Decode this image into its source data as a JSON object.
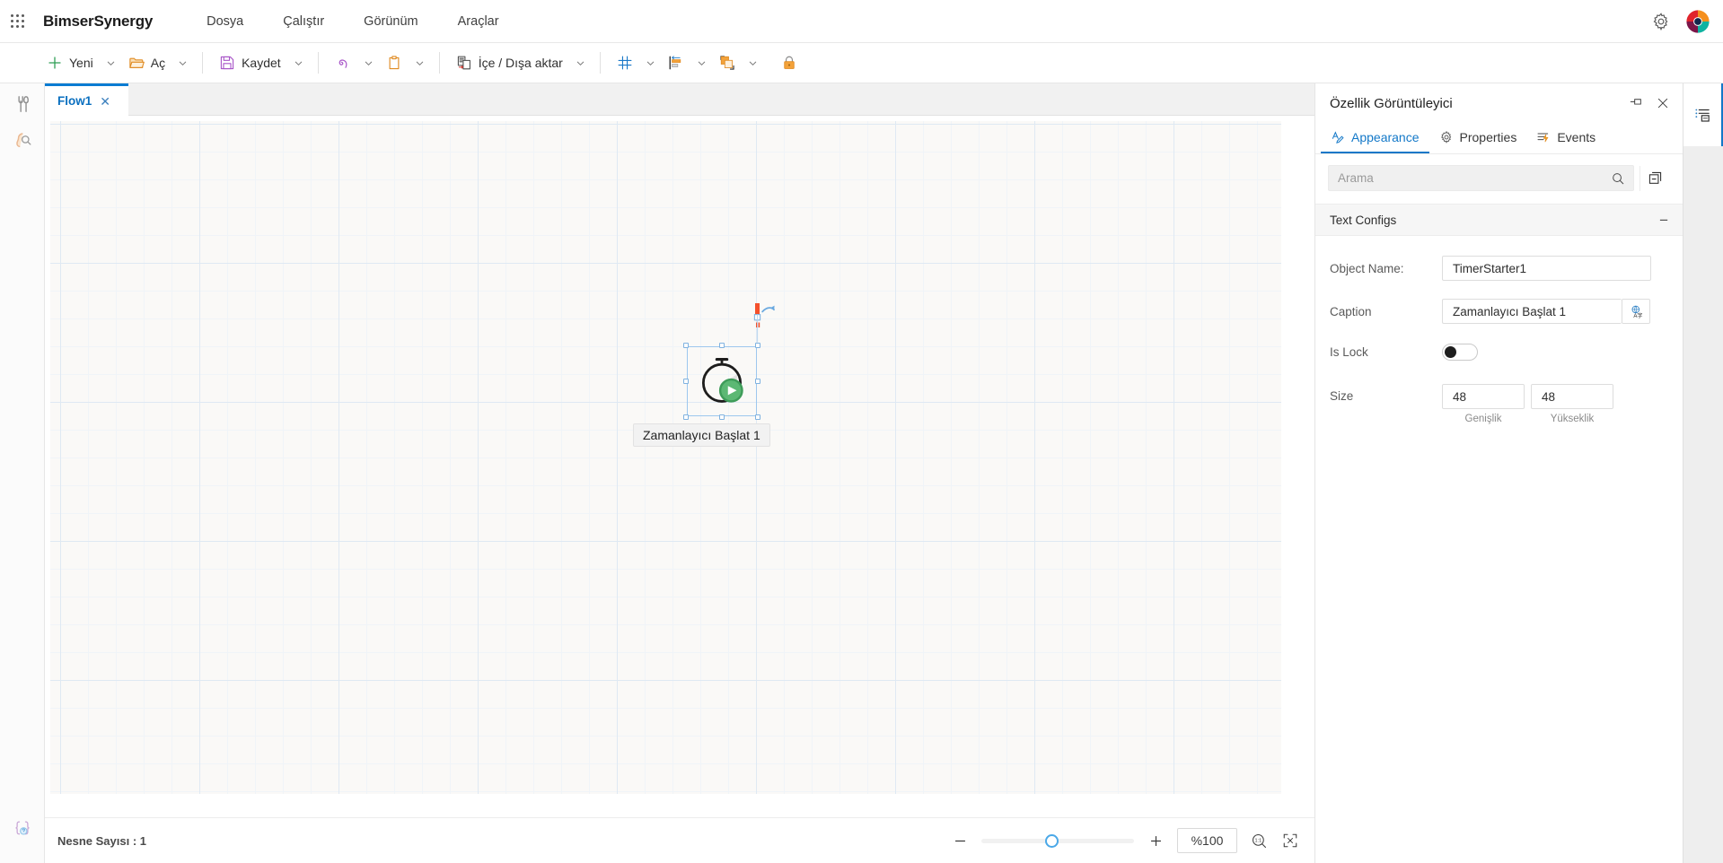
{
  "topbar": {
    "waffle_icon": "grid-apps-icon",
    "brand": "BimserSynergy",
    "menus": [
      {
        "label": "Dosya"
      },
      {
        "label": "Çalıştır"
      },
      {
        "label": "Görünüm"
      },
      {
        "label": "Araçlar"
      }
    ],
    "settings_icon": "gear-icon",
    "avatar_icon": "user-avatar-pinwheel"
  },
  "toolbar": {
    "items": [
      {
        "label": "Yeni",
        "icon": "plus-icon",
        "caret": true
      },
      {
        "label": "Aç",
        "icon": "folder-open-icon",
        "caret": true
      },
      {
        "label": "Kaydet",
        "icon": "floppy-save-icon",
        "caret": true
      },
      {
        "label": "",
        "icon": "undo-icon",
        "caret": true
      },
      {
        "label": "",
        "icon": "clipboard-paste-icon",
        "caret": true
      },
      {
        "label": "İçe / Dışa aktar",
        "icon": "import-export-icon",
        "caret": true
      },
      {
        "label": "",
        "icon": "grid-icon",
        "caret": true
      },
      {
        "label": "",
        "icon": "align-left-icon",
        "caret": true
      },
      {
        "label": "",
        "icon": "bring-to-front-icon",
        "caret": true
      },
      {
        "label": "",
        "icon": "lock-icon",
        "caret": false
      }
    ]
  },
  "left_rail": {
    "items": [
      {
        "icon": "toolbox-tools-icon"
      },
      {
        "icon": "inspect-search-icon"
      },
      {
        "icon": "variables-braces-icon"
      }
    ]
  },
  "editor": {
    "tabs": [
      {
        "label": "Flow1",
        "close_icon": "close-icon",
        "active": true
      }
    ]
  },
  "canvas": {
    "node": {
      "icon": "timer-starter-stopwatch-play-icon",
      "label": "Zamanlayıcı Başlat 1",
      "rotate_handle_icon": "rotate-handle-icon",
      "selected": true,
      "handle_count": 8
    }
  },
  "statusbar": {
    "object_count_label": "Nesne Sayısı : 1",
    "zoom_out_icon": "minus-icon",
    "zoom_in_icon": "plus-icon",
    "zoom_value": "%100",
    "actual_size_icon": "zoom-one-to-one-icon",
    "fit_screen_icon": "fit-to-screen-icon",
    "slider_percent": 42
  },
  "right_panel": {
    "title": "Özellik Görüntüleyici",
    "pin_icon": "pin-icon",
    "close_icon": "close-icon",
    "tabs": [
      {
        "label": "Appearance",
        "icon": "appearance-pen-icon",
        "active": true
      },
      {
        "label": "Properties",
        "icon": "gear-icon",
        "active": false
      },
      {
        "label": "Events",
        "icon": "events-lightning-icon",
        "active": false
      }
    ],
    "search": {
      "placeholder": "Arama",
      "value": "",
      "search_icon": "search-icon"
    },
    "collapse_all_icon": "collapse-all-icon",
    "section": {
      "title": "Text Configs",
      "toggle_state": "expanded",
      "toggle_glyph": "−"
    },
    "fields": {
      "object_name": {
        "label": "Object Name:",
        "value": "TimerStarter1"
      },
      "caption": {
        "label": "Caption",
        "value": "Zamanlayıcı Başlat 1",
        "translate_icon": "translate-globe-icon"
      },
      "is_lock": {
        "label": "Is Lock",
        "value": "off"
      },
      "size": {
        "label": "Size",
        "width_value": "48",
        "width_caption": "Genişlik",
        "height_value": "48",
        "height_caption": "Yükseklik"
      }
    }
  },
  "right_rail": {
    "items": [
      {
        "icon": "properties-list-panel-icon",
        "active": true
      }
    ]
  },
  "colors": {
    "accent": "#1378c8",
    "tab_active": "#0a6fbf",
    "canvas_bg": "#faf9f7",
    "grid_line": "#dfe9f3",
    "node_green": "#4caf72",
    "handle_blue": "#7fb2e0"
  }
}
